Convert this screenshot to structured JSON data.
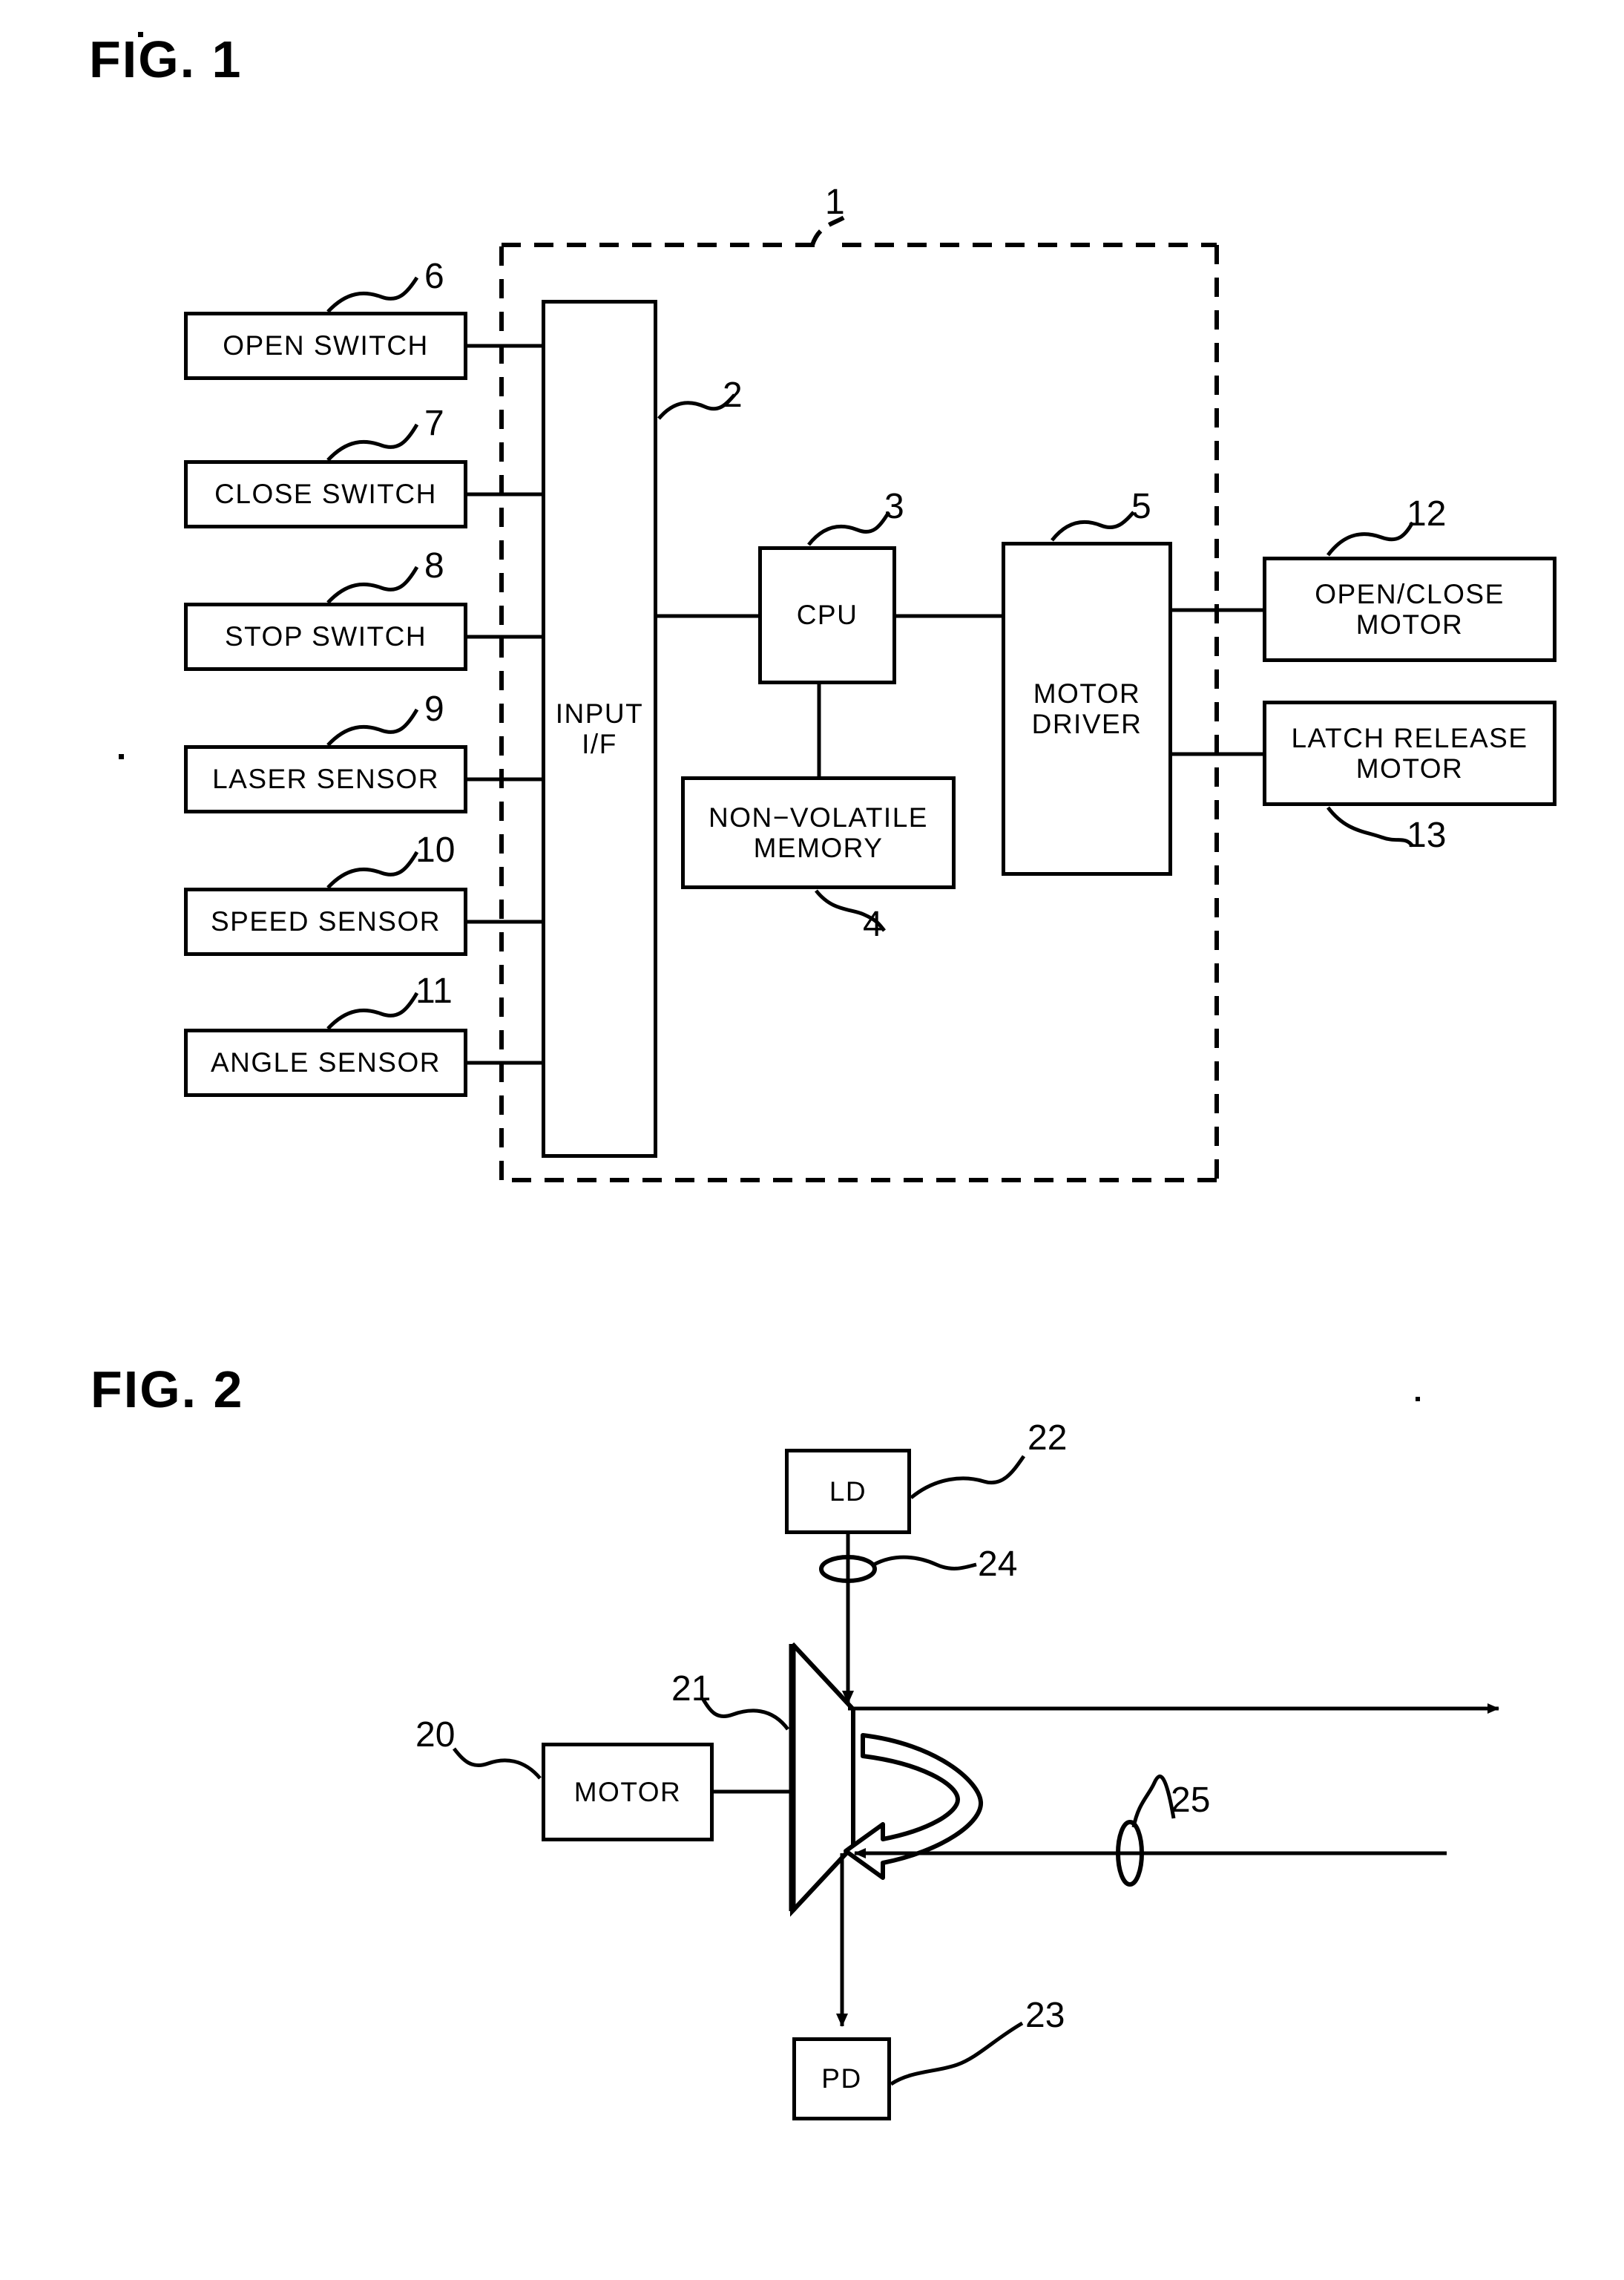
{
  "figures": [
    {
      "id": "fig1",
      "title": "FIG. 1",
      "enclosure_ref": "1",
      "blocks": [
        {
          "key": "open_switch",
          "label": "OPEN SWITCH",
          "ref": "6"
        },
        {
          "key": "close_switch",
          "label": "CLOSE SWITCH",
          "ref": "7"
        },
        {
          "key": "stop_switch",
          "label": "STOP SWITCH",
          "ref": "8"
        },
        {
          "key": "laser_sensor",
          "label": "LASER SENSOR",
          "ref": "9"
        },
        {
          "key": "speed_sensor",
          "label": "SPEED SENSOR",
          "ref": "10"
        },
        {
          "key": "angle_sensor",
          "label": "ANGLE SENSOR",
          "ref": "11"
        },
        {
          "key": "input_if",
          "label": "INPUT\nI/F",
          "ref": "2"
        },
        {
          "key": "cpu",
          "label": "CPU",
          "ref": "3"
        },
        {
          "key": "nvmem",
          "label": "NON−VOLATILE\nMEMORY",
          "ref": "4"
        },
        {
          "key": "motor_driver",
          "label": "MOTOR\nDRIVER",
          "ref": "5"
        },
        {
          "key": "oc_motor",
          "label": "OPEN/CLOSE\nMOTOR",
          "ref": "12"
        },
        {
          "key": "latch_motor",
          "label": "LATCH RELEASE\nMOTOR",
          "ref": "13"
        }
      ]
    },
    {
      "id": "fig2",
      "title": "FIG. 2",
      "blocks": [
        {
          "key": "ld",
          "label": "LD",
          "ref": "22"
        },
        {
          "key": "motor",
          "label": "MOTOR",
          "ref": "20"
        },
        {
          "key": "pd",
          "label": "PD",
          "ref": "23"
        }
      ],
      "parts": [
        {
          "key": "polygon_mirror",
          "ref": "21"
        },
        {
          "key": "collimator_lens",
          "ref": "24"
        },
        {
          "key": "receiver_lens",
          "ref": "25"
        }
      ]
    }
  ],
  "labels": {
    "fig1_title": "FIG. 1",
    "fig2_title": "FIG. 2",
    "open_switch": "OPEN SWITCH",
    "close_switch": "CLOSE SWITCH",
    "stop_switch": "STOP SWITCH",
    "laser_sensor": "LASER SENSOR",
    "speed_sensor": "SPEED SENSOR",
    "angle_sensor": "ANGLE SENSOR",
    "input_if_line1": "INPUT",
    "input_if_line2": "I/F",
    "cpu": "CPU",
    "nvmem_line1": "NON−VOLATILE",
    "nvmem_line2": "MEMORY",
    "motor_driver_line1": "MOTOR",
    "motor_driver_line2": "DRIVER",
    "oc_motor_line1": "OPEN/CLOSE",
    "oc_motor_line2": "MOTOR",
    "latch_motor_line1": "LATCH RELEASE",
    "latch_motor_line2": "MOTOR",
    "ld": "LD",
    "motor": "MOTOR",
    "pd": "PD"
  },
  "refs": {
    "r1": "1",
    "r2": "2",
    "r3": "3",
    "r4": "4",
    "r5": "5",
    "r6": "6",
    "r7": "7",
    "r8": "8",
    "r9": "9",
    "r10": "10",
    "r11": "11",
    "r12": "12",
    "r13": "13",
    "r20": "20",
    "r21": "21",
    "r22": "22",
    "r23": "23",
    "r24": "24",
    "r25": "25"
  },
  "colors": {
    "ink": "#000000",
    "paper": "#ffffff"
  }
}
